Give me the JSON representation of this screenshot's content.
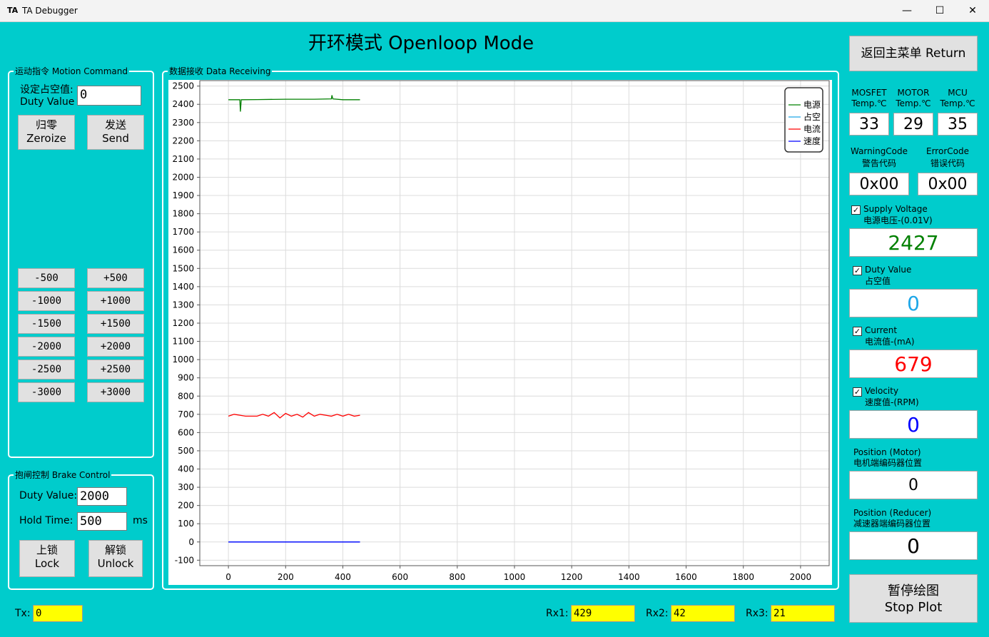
{
  "window": {
    "app_icon": "TA",
    "title": "TA Debugger",
    "minimize": "—",
    "maximize": "☐",
    "close": "✕"
  },
  "header": {
    "title": "开环模式 Openloop Mode"
  },
  "motion": {
    "legend": "运动指令 Motion Command",
    "duty_label_1": "设定占空值:",
    "duty_label_2": "Duty Value",
    "duty_value": "0",
    "zeroize_1": "归零",
    "zeroize_2": "Zeroize",
    "send_1": "发送",
    "send_2": "Send",
    "steps_minus": [
      "-500",
      "-1000",
      "-1500",
      "-2000",
      "-2500",
      "-3000"
    ],
    "steps_plus": [
      "+500",
      "+1000",
      "+1500",
      "+2000",
      "+2500",
      "+3000"
    ]
  },
  "brake": {
    "legend": "抱闸控制 Brake Control",
    "duty_label": "Duty Value:",
    "duty_value": "2000",
    "hold_label": "Hold  Time:",
    "hold_value": "500",
    "hold_unit": "ms",
    "lock_1": "上锁",
    "lock_2": "Lock",
    "unlock_1": "解锁",
    "unlock_2": "Unlock"
  },
  "data_group": {
    "legend": "数据接收 Data Receiving"
  },
  "chart_data": {
    "type": "line",
    "xlim": [
      -100,
      2100
    ],
    "ylim": [
      -130,
      2530
    ],
    "x_ticks": [
      0,
      200,
      400,
      600,
      800,
      1000,
      1200,
      1400,
      1600,
      1800,
      2000
    ],
    "y_ticks": [
      -100,
      0,
      100,
      200,
      300,
      400,
      500,
      600,
      700,
      800,
      900,
      1000,
      1100,
      1200,
      1300,
      1400,
      1500,
      1600,
      1700,
      1800,
      1900,
      2000,
      2100,
      2200,
      2300,
      2400,
      2500
    ],
    "grid": true,
    "legend_position": "top-right",
    "series": [
      {
        "name": "电源",
        "color": "#008000",
        "x": [
          0,
          40,
          42,
          45,
          100,
          200,
          300,
          360,
          362,
          365,
          400,
          460
        ],
        "y": [
          2425,
          2425,
          2360,
          2425,
          2426,
          2428,
          2428,
          2430,
          2450,
          2430,
          2425,
          2425
        ]
      },
      {
        "name": "占空",
        "color": "#1EA7E8",
        "x": [
          0,
          460
        ],
        "y": [
          0,
          0
        ]
      },
      {
        "name": "电流",
        "color": "#FF0000",
        "x": [
          0,
          20,
          40,
          60,
          100,
          120,
          140,
          160,
          180,
          200,
          220,
          240,
          260,
          280,
          300,
          320,
          340,
          360,
          380,
          400,
          420,
          440,
          460
        ],
        "y": [
          690,
          700,
          695,
          690,
          690,
          700,
          690,
          710,
          680,
          705,
          690,
          700,
          685,
          710,
          690,
          700,
          695,
          690,
          700,
          690,
          700,
          690,
          695
        ]
      },
      {
        "name": "速度",
        "color": "#0000FF",
        "x": [
          0,
          460
        ],
        "y": [
          0,
          0
        ]
      }
    ]
  },
  "status": {
    "mosfet_1": "MOSFET",
    "mosfet_2": "Temp.℃",
    "mosfet_val": "33",
    "motor_1": "MOTOR",
    "motor_2": "Temp.℃",
    "motor_val": "29",
    "mcu_1": "MCU",
    "mcu_2": "Temp.℃",
    "mcu_val": "35",
    "warn_1": "WarningCode",
    "warn_2": "警告代码",
    "warn_val": "0x00",
    "err_1": "ErrorCode",
    "err_2": "错误代码",
    "err_val": "0x00",
    "supply_1": "Supply Voltage",
    "supply_2": "电源电压-(0.01V)",
    "supply_val": "2427",
    "supply_color": "#008000",
    "duty_1": "Duty Value",
    "duty_2": "占空值",
    "duty_val": "0",
    "duty_color": "#1EA7E8",
    "current_1": "Current",
    "current_2": "电流值-(mA)",
    "current_val": "679",
    "current_color": "#FF0000",
    "vel_1": "Velocity",
    "vel_2": "速度值-(RPM)",
    "vel_val": "0",
    "vel_color": "#0000FF",
    "posm_1": "Position (Motor)",
    "posm_2": "电机端编码器位置",
    "posm_val": "0",
    "posr_1": "Position (Reducer)",
    "posr_2": "减速器端编码器位置",
    "posr_val": "0",
    "check": "✓"
  },
  "buttons": {
    "return": "返回主菜单 Return",
    "stop_1": "暂停绘图",
    "stop_2": "Stop Plot"
  },
  "footer": {
    "tx_label": "Tx:",
    "tx_val": "0",
    "rx1_label": "Rx1:",
    "rx1_val": "429",
    "rx2_label": "Rx2:",
    "rx2_val": "42",
    "rx3_label": "Rx3:",
    "rx3_val": "21"
  }
}
